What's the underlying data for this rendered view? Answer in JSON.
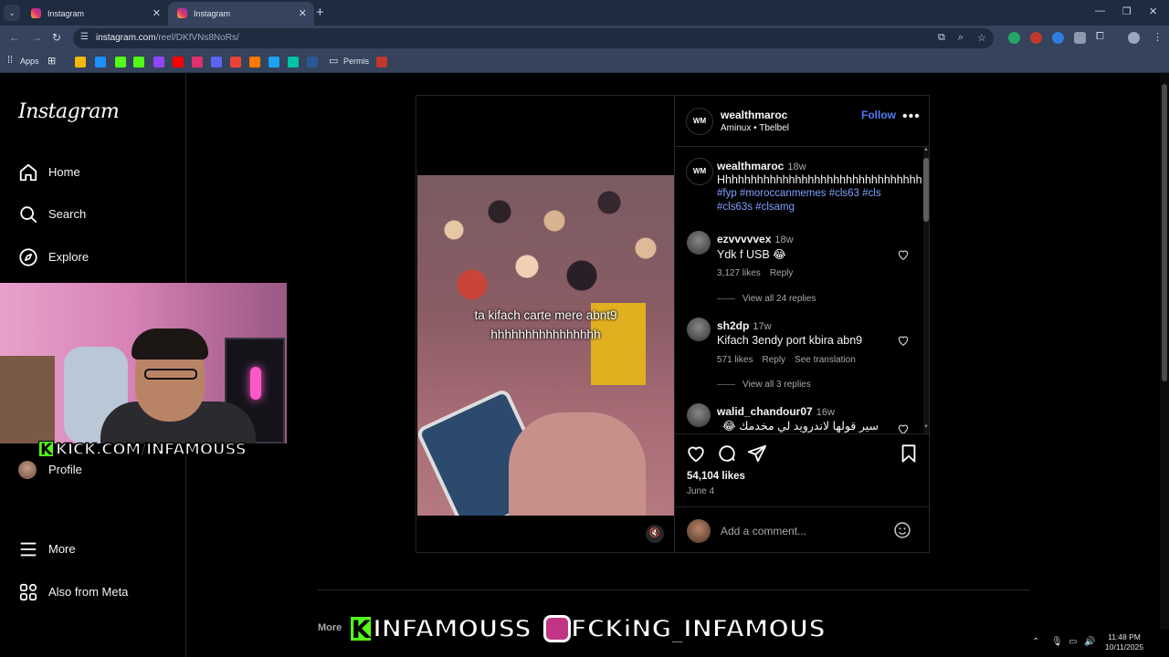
{
  "browser": {
    "tabs": [
      {
        "title": "Instagram",
        "active": false
      },
      {
        "title": "Instagram",
        "active": true
      }
    ],
    "url_host": "instagram.com",
    "url_path": "/reel/DKfVNs8NoRs/",
    "bookmarks": {
      "apps_label": "Apps",
      "folder_label": "Permis"
    }
  },
  "sidebar": {
    "logo": "Instagram",
    "items": [
      {
        "label": "Home",
        "icon": "home-icon"
      },
      {
        "label": "Search",
        "icon": "search-icon"
      },
      {
        "label": "Explore",
        "icon": "compass-icon"
      },
      {
        "label": "Profile",
        "icon": "avatar"
      },
      {
        "label": "More",
        "icon": "menu-icon"
      },
      {
        "label": "Also from Meta",
        "icon": "meta-icon"
      }
    ]
  },
  "overlay": {
    "kick_url": "KICK.COM/INFAMOUSS",
    "banner_kick": "INFAMOUSS",
    "banner_ig": "FCKiNG_INFAMOUS"
  },
  "post": {
    "video_caption_line1": "ta kifach carte mere abnt9",
    "video_caption_line2": "hhhhhhhhhhhhhhhh",
    "author": {
      "avatar_text": "WM",
      "username": "wealthmaroc",
      "audio": "Aminux • Tbelbel"
    },
    "follow_label": "Follow",
    "caption": {
      "username": "wealthmaroc",
      "time": "18w",
      "text": "Hhhhhhhhhhhhhhhhhhhhhhhhhhhhhhhh",
      "tags_line1": "#fyp #moroccanmemes #cls63 #cls",
      "tags_line2": "#cls63s #clsamg"
    },
    "comments": [
      {
        "username": "ezvvvvvex",
        "time": "18w",
        "text": "Ydk f USB 😂",
        "likes": "3,127 likes",
        "reply": "Reply",
        "translate": "",
        "replies": "View all 24 replies"
      },
      {
        "username": "sh2dp",
        "time": "17w",
        "text": "Kifach 3endy port kbira abn9",
        "likes": "571 likes",
        "reply": "Reply",
        "translate": "See translation",
        "replies": "View all 3 replies"
      },
      {
        "username": "walid_chandour07",
        "time": "16w",
        "text": "سير قولها لاندرويد لي مخدمك 😂",
        "likes": "",
        "reply": "",
        "translate": "",
        "replies": ""
      }
    ],
    "likes_count": "54,104 likes",
    "date": "June 4",
    "add_comment_placeholder": "Add a comment...",
    "more_from": "More"
  },
  "taskbar": {
    "time": "11:48 PM",
    "date": "10/11/2025"
  },
  "colors": {
    "link_blue": "#4f7cf7",
    "hashtag": "#7ea1ff",
    "kick_green": "#53fc18",
    "browser_frame": "#35435c"
  }
}
